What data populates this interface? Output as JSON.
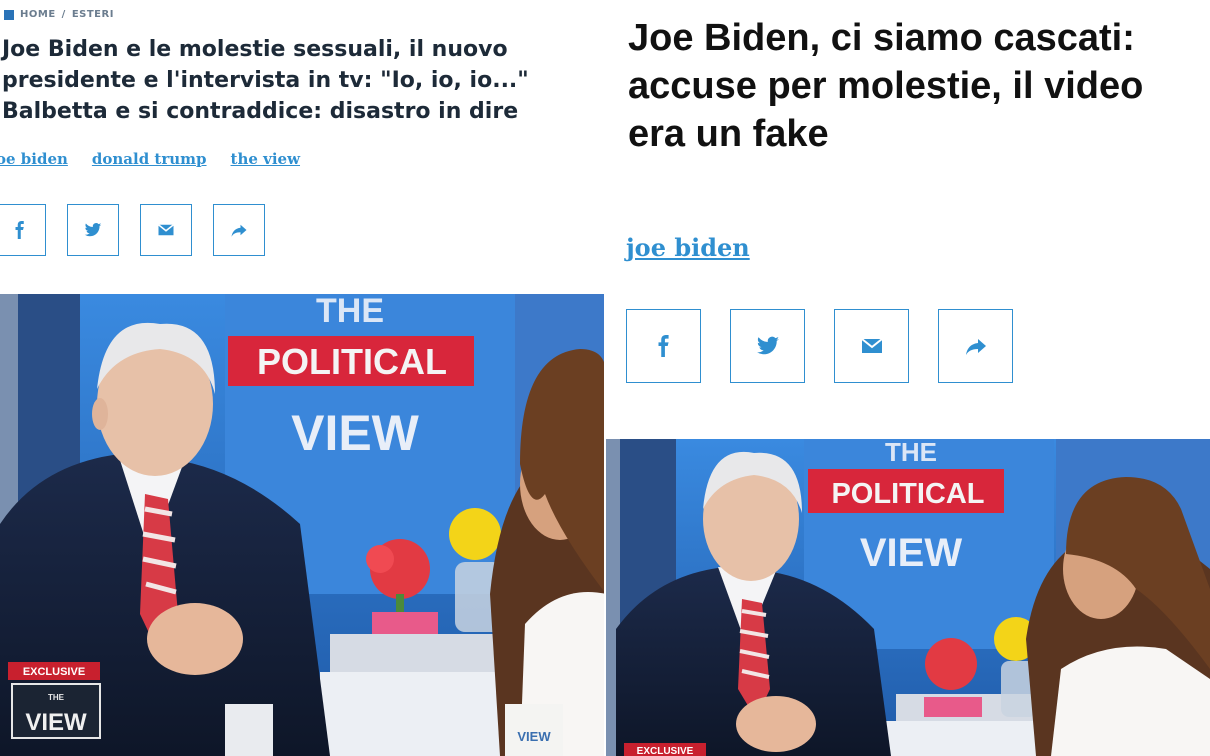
{
  "left": {
    "breadcrumb": {
      "home": "HOME",
      "separator": "/",
      "section": "ESTERI"
    },
    "headline_lines": [
      "Joe Biden e le molestie sessuali, il nuovo",
      "presidente e l'intervista in tv: \"Io, io, io...\"",
      "Balbetta e si contraddice: disastro in dire"
    ],
    "tags": [
      "oe biden",
      "donald trump",
      "the view"
    ],
    "video": {
      "show_line1": "THE",
      "show_line2": "POLITICAL",
      "show_line3": "VIEW",
      "badge": "EXCLUSIVE",
      "logo_small": "THE",
      "logo_big": "VIEW",
      "mug": "VIEW"
    }
  },
  "right": {
    "headline": "Joe Biden, ci siamo cascati: accuse per molestie, il video era un fake",
    "tags": [
      "joe biden"
    ],
    "video": {
      "show_line1": "THE",
      "show_line2": "POLITICAL",
      "show_line3": "VIEW",
      "badge": "EXCLUSIVE"
    }
  },
  "share_buttons": [
    "facebook-icon",
    "twitter-icon",
    "mail-icon",
    "share-icon"
  ],
  "colors": {
    "accent": "#2f8fd0",
    "headline": "#1d2a38",
    "brand_red": "#c8202e",
    "studio_blue": "#2d6fc0"
  }
}
